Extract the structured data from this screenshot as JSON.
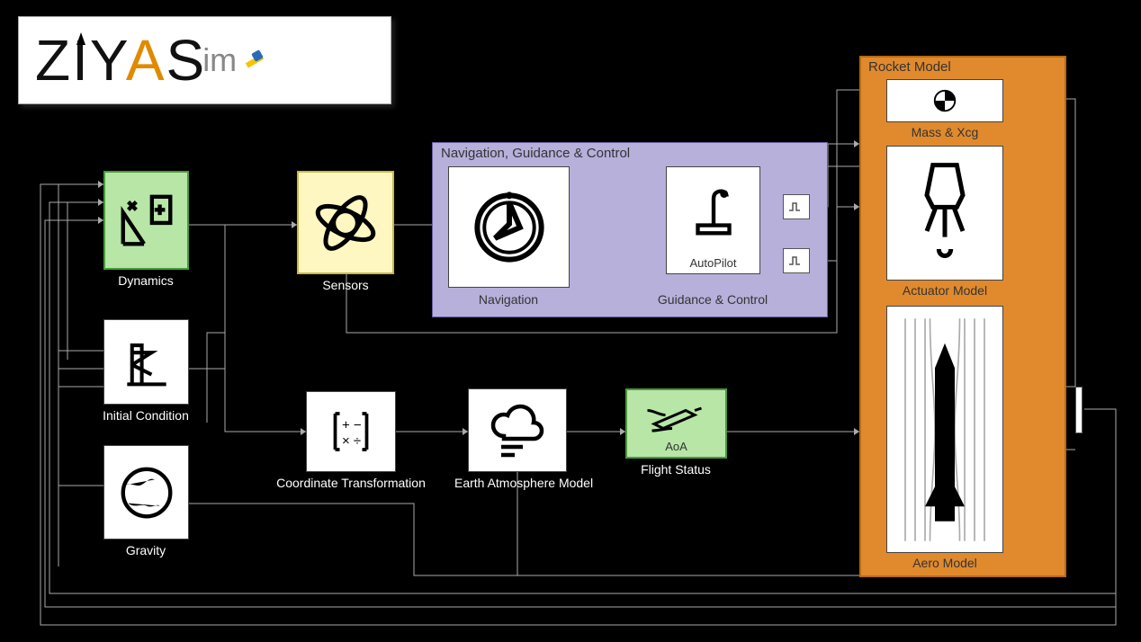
{
  "logo": {
    "brand_z": "Z",
    "brand_i": "I",
    "brand_y": "Y",
    "brand_a": "A",
    "brand_s": "S",
    "brand_im": "im"
  },
  "blocks": {
    "dynamics": "Dynamics",
    "initial_condition": "Initial Condition",
    "gravity": "Gravity",
    "sensors": "Sensors",
    "navigation": "Navigation",
    "autopilot": "AutoPilot",
    "guidance_control": "Guidance & Control",
    "coord_transform": "Coordinate Transformation",
    "atmosphere": "Earth Atmosphere Model",
    "aoa": "AoA",
    "flight_status": "Flight Status",
    "mass_xcg": "Mass & Xcg",
    "actuator": "Actuator Model",
    "aero": "Aero Model"
  },
  "groups": {
    "nav_title": "Navigation, Guidance & Control",
    "rocket_title": "Rocket Model"
  }
}
